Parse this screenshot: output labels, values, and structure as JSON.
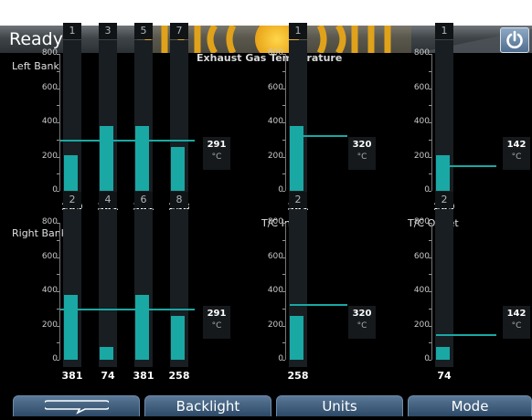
{
  "status": "Ready",
  "title": "Exhaust Gas Temperature",
  "sections": {
    "left_bank": "Left Bank",
    "right_bank": "Right Bank",
    "tc_inlet": "T/C Inlet",
    "tc_outlet": "T/C Outlet"
  },
  "unit": "°C",
  "ticks": [
    "800",
    "600",
    "400",
    "200",
    "0"
  ],
  "left_bank": {
    "cylinders": [
      {
        "label": "1",
        "value": 209
      },
      {
        "label": "3",
        "value": 381
      },
      {
        "label": "5",
        "value": 381
      },
      {
        "label": "7",
        "value": 258
      }
    ],
    "average": "291"
  },
  "right_bank": {
    "cylinders": [
      {
        "label": "2",
        "value": 381
      },
      {
        "label": "4",
        "value": 74
      },
      {
        "label": "6",
        "value": 381
      },
      {
        "label": "8",
        "value": 258
      }
    ],
    "average": "291"
  },
  "tc_inlet_1": {
    "label": "1",
    "value": 381,
    "setpoint": "320"
  },
  "tc_inlet_2": {
    "label": "2",
    "value": 258,
    "setpoint": "320"
  },
  "tc_outlet_1": {
    "label": "1",
    "value": 209,
    "setpoint": "142"
  },
  "tc_outlet_2": {
    "label": "2",
    "value": 74,
    "setpoint": "142"
  },
  "softkeys": [
    "",
    "Backlight",
    "Units",
    "Mode"
  ],
  "colors": {
    "accent": "#1aa8a4",
    "button": "#3d5c7c"
  },
  "icons": {
    "power": "power-icon",
    "speech": "speech-bubble-icon"
  }
}
